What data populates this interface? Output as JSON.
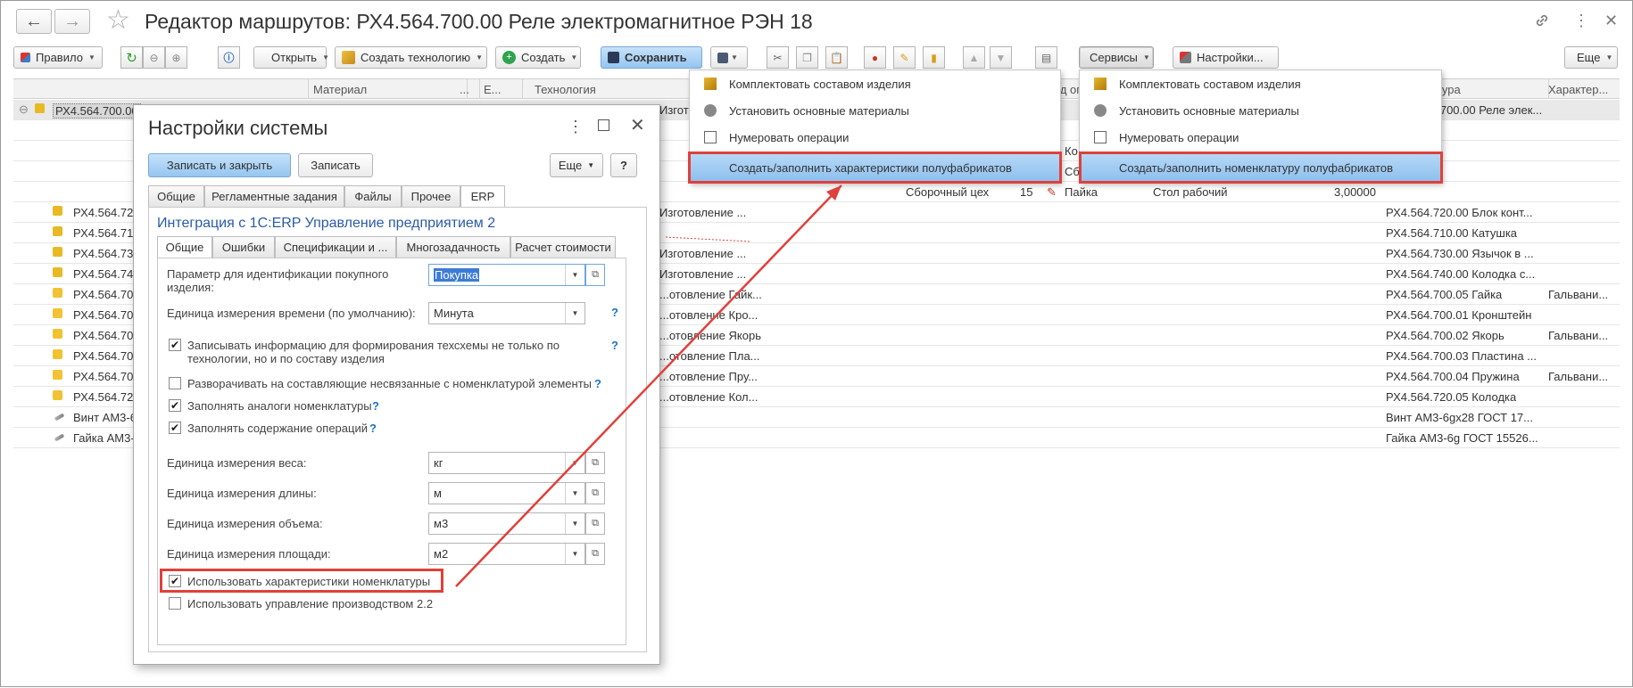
{
  "window": {
    "title": "Редактор маршрутов: РХ4.564.700.00 Реле электромагнитное РЭН 18",
    "back": "←",
    "forward": "→",
    "star": "☆",
    "link_icon": "🔗",
    "more_icon": "⋮",
    "close_icon": "✕"
  },
  "toolbar": {
    "rule": "Правило",
    "open": "Открыть",
    "create_tech": "Создать технологию",
    "create": "Создать",
    "save": "Сохранить",
    "services": "Сервисы",
    "settings": "Настройки...",
    "more": "Еще"
  },
  "grid": {
    "headers": [
      "Материал",
      "...",
      "Е...",
      "Технология",
      "...д оп",
      "...тура",
      "Характер..."
    ],
    "root_row": {
      "code": "РХ4.564.700.00",
      "tech": "Изготовление ...",
      "nom": "...700.00 Реле элек..."
    },
    "rows": [
      {
        "code": "РХ4.564.720",
        "tech": "Изготовление ...",
        "nom": "РХ4.564.720.00 Блок конт...",
        "ch": ""
      },
      {
        "code": "РХ4.564.710",
        "tech": "",
        "nom": "РХ4.564.710.00 Катушка",
        "ch": ""
      },
      {
        "code": "РХ4.564.730",
        "tech": "Изготовление ...",
        "nom": "РХ4.564.730.00 Язычок в ...",
        "ch": ""
      },
      {
        "code": "РХ4.564.740",
        "tech": "Изготовление ...",
        "nom": "РХ4.564.740.00 Колодка с...",
        "ch": ""
      },
      {
        "code": "РХ4.564.700",
        "tech": "...отовление Гайк...",
        "nom": "РХ4.564.700.05 Гайка",
        "ch": "Гальвани..."
      },
      {
        "code": "РХ4.564.700",
        "tech": "...отовление Кро...",
        "nom": "РХ4.564.700.01 Кронштейн",
        "ch": ""
      },
      {
        "code": "РХ4.564.700",
        "tech": "...отовление Якорь",
        "nom": "РХ4.564.700.02 Якорь",
        "ch": "Гальвани..."
      },
      {
        "code": "РХ4.564.700",
        "tech": "...отовление Пла...",
        "nom": "РХ4.564.700.03 Пластина ...",
        "ch": ""
      },
      {
        "code": "РХ4.564.700",
        "tech": "...отовление Пру...",
        "nom": "РХ4.564.700.04 Пружина",
        "ch": "Гальвани..."
      },
      {
        "code": "РХ4.564.720",
        "tech": "...отовление Кол...",
        "nom": "РХ4.564.720.05 Колодка",
        "ch": ""
      },
      {
        "code": "Винт АМ3-6",
        "tech": "",
        "nom": "Винт АМ3-6gx28 ГОСТ 17...",
        "ch": ""
      },
      {
        "code": "Гайка АМ3-",
        "tech": "",
        "nom": "Гайка АМ3-6g ГОСТ 15526...",
        "ch": ""
      }
    ],
    "partial": {
      "ko": "Ко",
      "sb": "Сб",
      "workshop": "Сборочный цех",
      "num": "15",
      "op": "Пайка",
      "table": "Стол рабочий",
      "qty": "3,00000"
    }
  },
  "menu1": {
    "items": [
      "Комплектовать составом изделия",
      "Установить основные материалы",
      "Нумеровать операции",
      "Создать/заполнить характеристики полуфабрикатов"
    ]
  },
  "menu2": {
    "items": [
      "Комплектовать составом изделия",
      "Установить основные материалы",
      "Нумеровать операции",
      "Создать/заполнить номенклатуру полуфабрикатов"
    ]
  },
  "dialog": {
    "title": "Настройки системы",
    "save_close": "Записать и закрыть",
    "save": "Записать",
    "more": "Еще",
    "help": "?",
    "tabs": [
      "Общие",
      "Регламентные задания",
      "Файлы",
      "Прочее",
      "ERP"
    ],
    "section": "Интеграция с 1С:ERP Управление предприятием 2",
    "subtabs": [
      "Общие",
      "Ошибки",
      "Спецификации и ...",
      "Многозадачность",
      "Расчет стоимости"
    ],
    "param_label": "Параметр для идентификации покупного изделия:",
    "param_value": "Покупка",
    "time_label": "Единица измерения времени (по умолчанию):",
    "time_value": "Минута",
    "cb_tech": "Записывать информацию для формирования техсхемы не только по технологии, но и по составу изделия",
    "cb_unfold": "Разворачивать на составляющие несвязанные с номенклатурой элементы",
    "cb_analogs": "Заполнять аналоги номенклатуры",
    "cb_content": "Заполнять содержание операций",
    "weight_label": "Единица измерения веса:",
    "weight_value": "кг",
    "length_label": "Единица измерения длины:",
    "length_value": "м",
    "volume_label": "Единица измерения объема:",
    "volume_value": "м3",
    "area_label": "Единица измерения площади:",
    "area_value": "м2",
    "cb_characteristics": "Использовать характеристики номенклатуры",
    "cb_production": "Использовать управление производством 2.2"
  }
}
